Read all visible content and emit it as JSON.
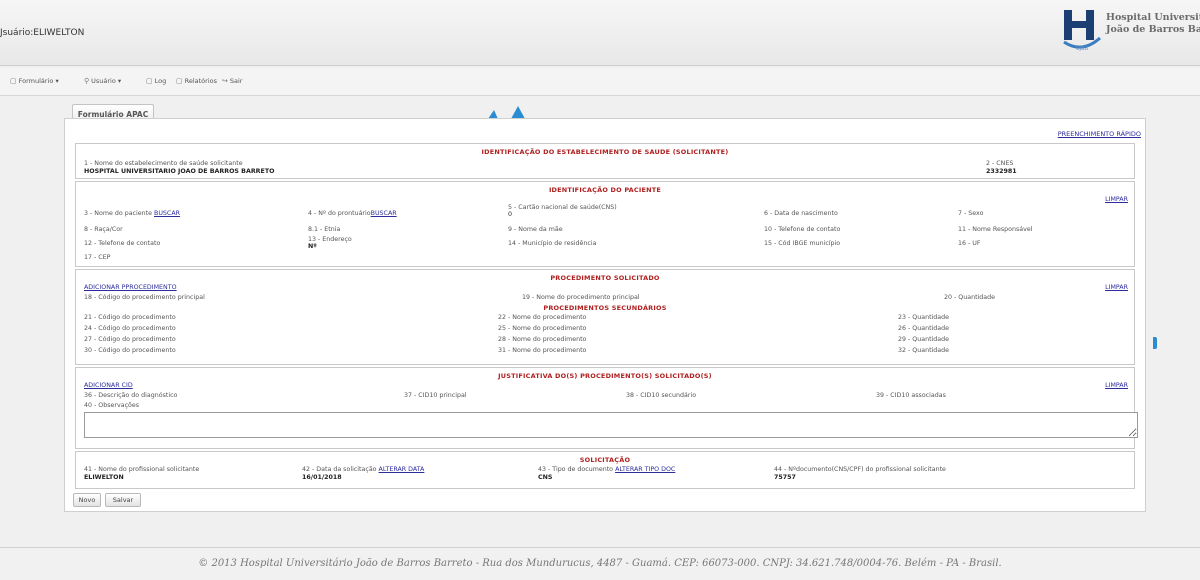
{
  "header": {
    "user_label": "Jsuário:ELIWELTON",
    "logo_line1": "Hospital Universitári",
    "logo_line2": "João de Barros Barret",
    "logo_badge": "UJBB"
  },
  "menu": {
    "formulario": "Formulário",
    "usuario": "Usuário",
    "log": "Log",
    "relatorios": "Relatórios",
    "sair": "Sair",
    "dropdown": "▾"
  },
  "tab": {
    "label": "Formulário APAC"
  },
  "form": {
    "quick_fill": "PREENCHIMENTO RÁPIDO",
    "limpar": "LIMPAR",
    "estab": {
      "title": "IDENTIFICAÇÃO DO ESTABELECIMENTO DE SAUDE (SOLICITANTE)",
      "name_label": "1 - Nome do estabelecimento de saúde solicitante",
      "name_value": "HOSPITAL UNIVERSITARIO JOAO DE BARROS BARRETO",
      "cnes_label": "2 - CNES",
      "cnes_value": "2332981"
    },
    "paciente": {
      "title": "IDENTIFICAÇÃO DO PACIENTE",
      "buscar": "BUSCAR",
      "f3": "3 - Nome do paciente",
      "f4": "4 - Nº do prontuário",
      "f5": "5 - Cartão nacional de saúde(CNS)",
      "f5_value": "0",
      "f6": "6 - Data de nascimento",
      "f7": "7 - Sexo",
      "f8": "8 - Raça/Cor",
      "f81": "8.1 - Etnia",
      "f9": "9 - Nome da mãe",
      "f10": "10 - Telefone de contato",
      "f11": "11 - Nome Responsável",
      "f12": "12 - Telefone de contato",
      "f13": "13 - Endereço",
      "f13_value": "Nº",
      "f14": "14 - Município de residência",
      "f15": "15 - Cód IBGE município",
      "f16": "16 - UF",
      "f17": "17 - CEP"
    },
    "procedimento": {
      "title": "PROCEDIMENTO SOLICITADO",
      "add": "ADICIONAR PPROCEDIMENTO",
      "f18": "18 - Código do procedimento principal",
      "f19": "19 - Nome do procedimento principal",
      "f20": "20 - Quantidade",
      "sec_title": "PROCEDIMENTOS SECUNDÁRIOS",
      "rows": [
        {
          "cod": "21 - Código do procedimento",
          "nome": "22 - Nome do procedimento",
          "qtd": "23 - Quantidade"
        },
        {
          "cod": "24 - Código do procedimento",
          "nome": "25 - Nome do procedimento",
          "qtd": "26 - Quantidade"
        },
        {
          "cod": "27 - Código do procedimento",
          "nome": "28 - Nome do procedimento",
          "qtd": "29 - Quantidade"
        },
        {
          "cod": "30 - Código do procedimento",
          "nome": "31 - Nome do procedimento",
          "qtd": "32 - Quantidade"
        }
      ]
    },
    "justificativa": {
      "title": "JUSTIFICATIVA DO(S) PROCEDIMENTO(S) SOLICITADO(S)",
      "add": "ADICIONAR CID",
      "f36": "36 - Descrição do diagnóstico",
      "f37": "37 - CID10 principal",
      "f38": "38 - CID10 secundário",
      "f39": "39 - CID10 associadas",
      "f40": "40 - Observações"
    },
    "solicitacao": {
      "title": "SOLICITAÇÃO",
      "f41": "41 - Nome do profissional solicitante",
      "f41_value": "ELIWELTON",
      "f42": "42 - Data da solicitação",
      "f42_link": "ALTERAR DATA",
      "f42_value": "16/01/2018",
      "f43": "43 - Tipo de documento",
      "f43_link": "ALTERAR TIPO DOC",
      "f43_value": "CNS",
      "f44": "44 - Nºdocumento(CNS/CPF) do profissional solicitante",
      "f44_value": "75757"
    }
  },
  "buttons": {
    "novo": "Novo",
    "salvar": "Salvar"
  },
  "footer": {
    "text": "© 2013 Hospital Universitário João de Barros Barreto - Rua dos Mundurucus, 4487 - Guamá. CEP: 66073-000. CNPJ: 34.621.748/0004-76. Belém - PA - Brasil."
  },
  "colors": {
    "section_title": "#b02020",
    "link": "#2c2c9c",
    "accent": "#2a8dd4"
  }
}
